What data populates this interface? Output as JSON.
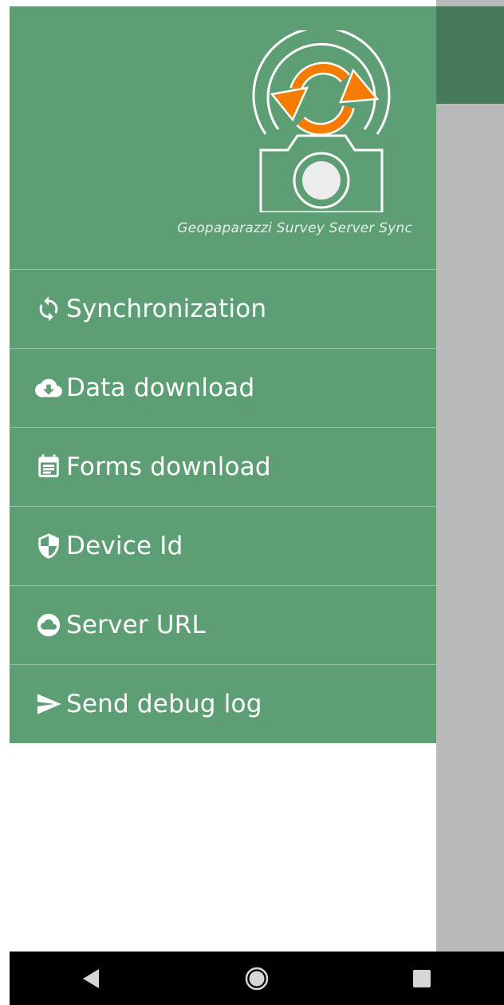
{
  "header": {
    "caption": "Geopaparazzi Survey Server Sync",
    "logo_icon": "sync-camera-logo-icon",
    "colors": {
      "header_bg": "#5d9e74",
      "logo_arrows": "#f57c00",
      "appbar": "#487a59"
    }
  },
  "menu": {
    "items": [
      {
        "label": "Synchronization",
        "icon": "sync-icon"
      },
      {
        "label": "Data download",
        "icon": "cloud-download-icon"
      },
      {
        "label": "Forms download",
        "icon": "form-calendar-icon"
      },
      {
        "label": "Device Id",
        "icon": "shield-icon"
      },
      {
        "label": "Server URL",
        "icon": "cloud-icon"
      },
      {
        "label": "Send debug log",
        "icon": "send-icon"
      }
    ]
  },
  "navbar": {
    "buttons": [
      {
        "icon": "back-triangle-icon"
      },
      {
        "icon": "home-circle-icon"
      },
      {
        "icon": "recents-square-icon"
      }
    ]
  }
}
